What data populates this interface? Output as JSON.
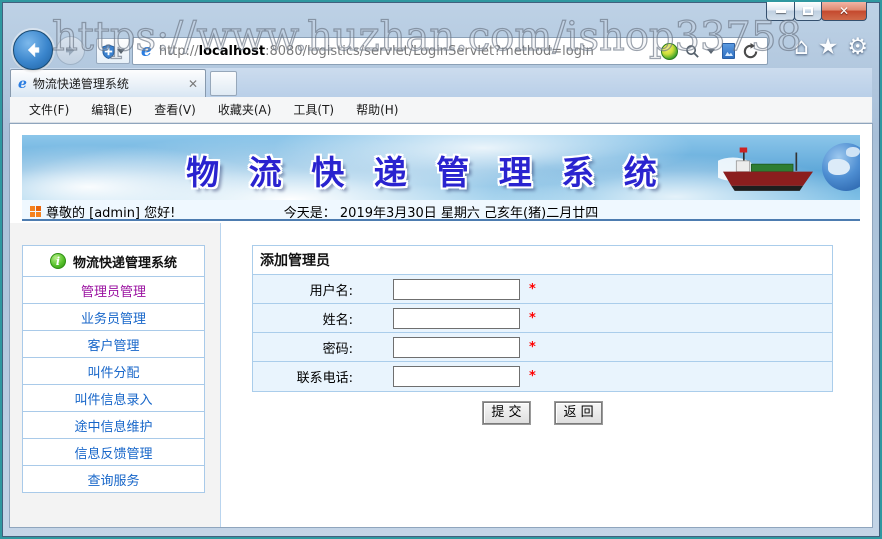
{
  "watermark": "https://www.huzhan.com/ishop33758",
  "browser": {
    "address": {
      "prefix": "http://",
      "host": "localhost",
      "rest": ":8080/logistics/servlet/LoginServlet?method=login"
    },
    "tab": {
      "title": "物流快递管理系统"
    },
    "menu": [
      "文件(F)",
      "编辑(E)",
      "查看(V)",
      "收藏夹(A)",
      "工具(T)",
      "帮助(H)"
    ],
    "icons": {
      "back": "back-arrow-icon",
      "forward": "forward-arrow-icon",
      "shield": "shield-plus-icon",
      "addon": "green-orb-icon",
      "search": "magnifier-icon",
      "page": "compatibility-page-icon",
      "refresh": "refresh-icon",
      "home": "home-icon",
      "favorites": "star-icon",
      "settings": "gear-icon"
    }
  },
  "page": {
    "banner_title": "物 流 快 递 管 理 系 统",
    "greeting": "尊敬的 [admin] 您好!",
    "today_line": "今天是： 2019年3月30日 星期六 己亥年(猪)二月廿四",
    "sidebar": {
      "header": "物流快递管理系统",
      "items": [
        "管理员管理",
        "业务员管理",
        "客户管理",
        "叫件分配",
        "叫件信息录入",
        "途中信息维护",
        "信息反馈管理",
        "查询服务"
      ]
    },
    "form": {
      "title": "添加管理员",
      "fields": [
        {
          "label": "用户名:",
          "value": "",
          "required": "*"
        },
        {
          "label": "姓名:",
          "value": "",
          "required": "*"
        },
        {
          "label": "密码:",
          "value": "",
          "required": "*"
        },
        {
          "label": "联系电话:",
          "value": "",
          "required": "*"
        }
      ],
      "buttons": {
        "submit": "提  交",
        "back": "返  回"
      }
    }
  },
  "colors": {
    "banner_title": "#2a23cf",
    "sidebar_link": "#1766c9",
    "sidebar_link_visited": "#9a11a0",
    "required_asterisk": "#ff0000",
    "table_border": "#aacdeb",
    "form_row_bg": "#e9f4fd",
    "status_underline": "#4d7cb0"
  }
}
